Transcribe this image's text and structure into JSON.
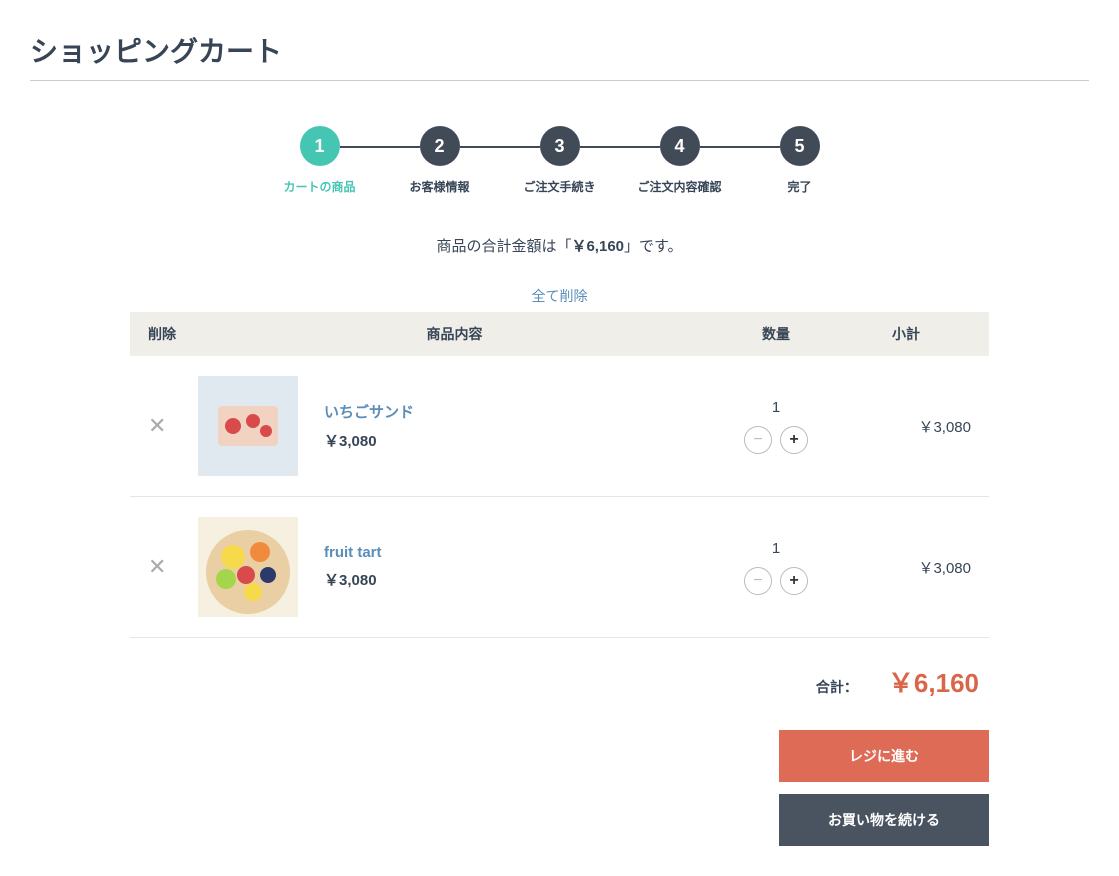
{
  "page": {
    "title": "ショッピングカート"
  },
  "steps": [
    {
      "num": "1",
      "label": "カートの商品",
      "active": true
    },
    {
      "num": "2",
      "label": "お客様情報",
      "active": false
    },
    {
      "num": "3",
      "label": "ご注文手続き",
      "active": false
    },
    {
      "num": "4",
      "label": "ご注文内容確認",
      "active": false
    },
    {
      "num": "5",
      "label": "完了",
      "active": false
    }
  ],
  "summary": {
    "prefix": "商品の合計金額は「",
    "price": "￥6,160",
    "suffix": "」です。"
  },
  "delete_all": "全て削除",
  "headers": {
    "delete": "削除",
    "product": "商品内容",
    "qty": "数量",
    "subtotal": "小計"
  },
  "items": [
    {
      "name": "いちごサンド",
      "price": "￥3,080",
      "qty": "1",
      "subtotal": "￥3,080"
    },
    {
      "name": "fruit tart",
      "price": "￥3,080",
      "qty": "1",
      "subtotal": "￥3,080"
    }
  ],
  "total": {
    "label": "合計：",
    "price": "￥6,160"
  },
  "buttons": {
    "checkout": "レジに進む",
    "continue": "お買い物を続ける"
  },
  "icons": {
    "delete": "✕",
    "minus": "−",
    "plus": "+"
  }
}
